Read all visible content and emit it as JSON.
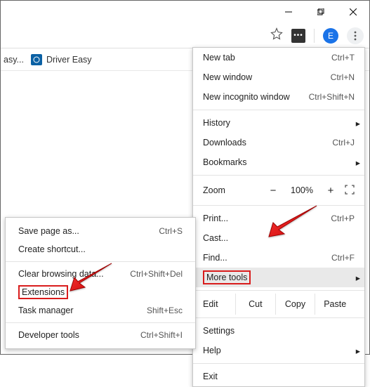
{
  "window": {
    "minimize": "–",
    "maximize": "❐",
    "close": "✕"
  },
  "toolbar": {
    "ext_badge": "•••",
    "avatar_letter": "E"
  },
  "bookmarks": {
    "item0_suffix": "asy...",
    "item1": "Driver Easy"
  },
  "menu": {
    "new_tab": "New tab",
    "new_tab_sc": "Ctrl+T",
    "new_window": "New window",
    "new_window_sc": "Ctrl+N",
    "new_incognito": "New incognito window",
    "new_incognito_sc": "Ctrl+Shift+N",
    "history": "History",
    "downloads": "Downloads",
    "downloads_sc": "Ctrl+J",
    "bookmarks": "Bookmarks",
    "zoom": "Zoom",
    "zoom_minus": "−",
    "zoom_pct": "100%",
    "zoom_plus": "+",
    "print": "Print...",
    "print_sc": "Ctrl+P",
    "cast": "Cast...",
    "find": "Find...",
    "find_sc": "Ctrl+F",
    "more_tools": "More tools",
    "edit": "Edit",
    "cut": "Cut",
    "copy": "Copy",
    "paste": "Paste",
    "settings": "Settings",
    "help": "Help",
    "exit": "Exit"
  },
  "submenu": {
    "save_page": "Save page as...",
    "save_page_sc": "Ctrl+S",
    "create_shortcut": "Create shortcut...",
    "clear_browsing": "Clear browsing data...",
    "clear_browsing_sc": "Ctrl+Shift+Del",
    "extensions": "Extensions",
    "task_manager": "Task manager",
    "task_manager_sc": "Shift+Esc",
    "developer_tools": "Developer tools",
    "developer_tools_sc": "Ctrl+Shift+I"
  }
}
